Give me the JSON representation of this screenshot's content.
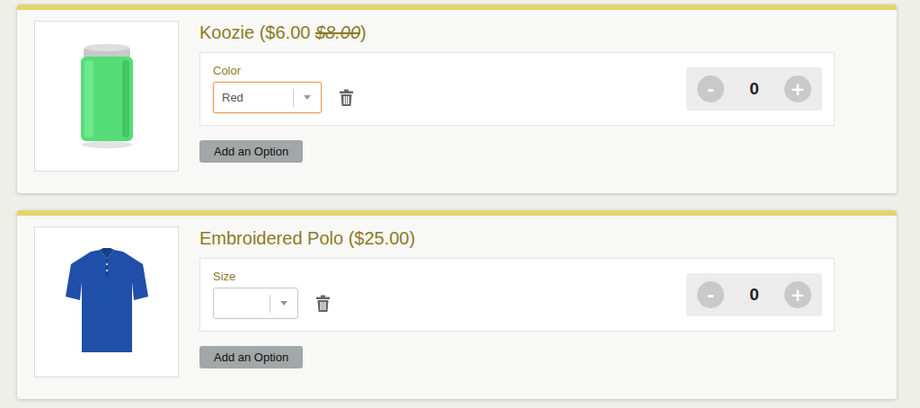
{
  "products": [
    {
      "kind": "can",
      "title": [
        {
          "text": "Koozie ($6.00 ",
          "struck": false
        },
        {
          "text": "$8.00",
          "struck": true
        },
        {
          "text": ")",
          "struck": false
        }
      ],
      "option": {
        "label": "Color",
        "value": "Red",
        "focused": true
      },
      "stepper": {
        "minus": "-",
        "quantity": "0",
        "plus": "+"
      },
      "add_button": "Add an Option"
    },
    {
      "kind": "shirt",
      "title": [
        {
          "text": "Embroidered Polo ($25.00)",
          "struck": false
        }
      ],
      "option": {
        "label": "Size",
        "value": "",
        "focused": false
      },
      "stepper": {
        "minus": "-",
        "quantity": "0",
        "plus": "+"
      },
      "add_button": "Add an Option"
    }
  ]
}
